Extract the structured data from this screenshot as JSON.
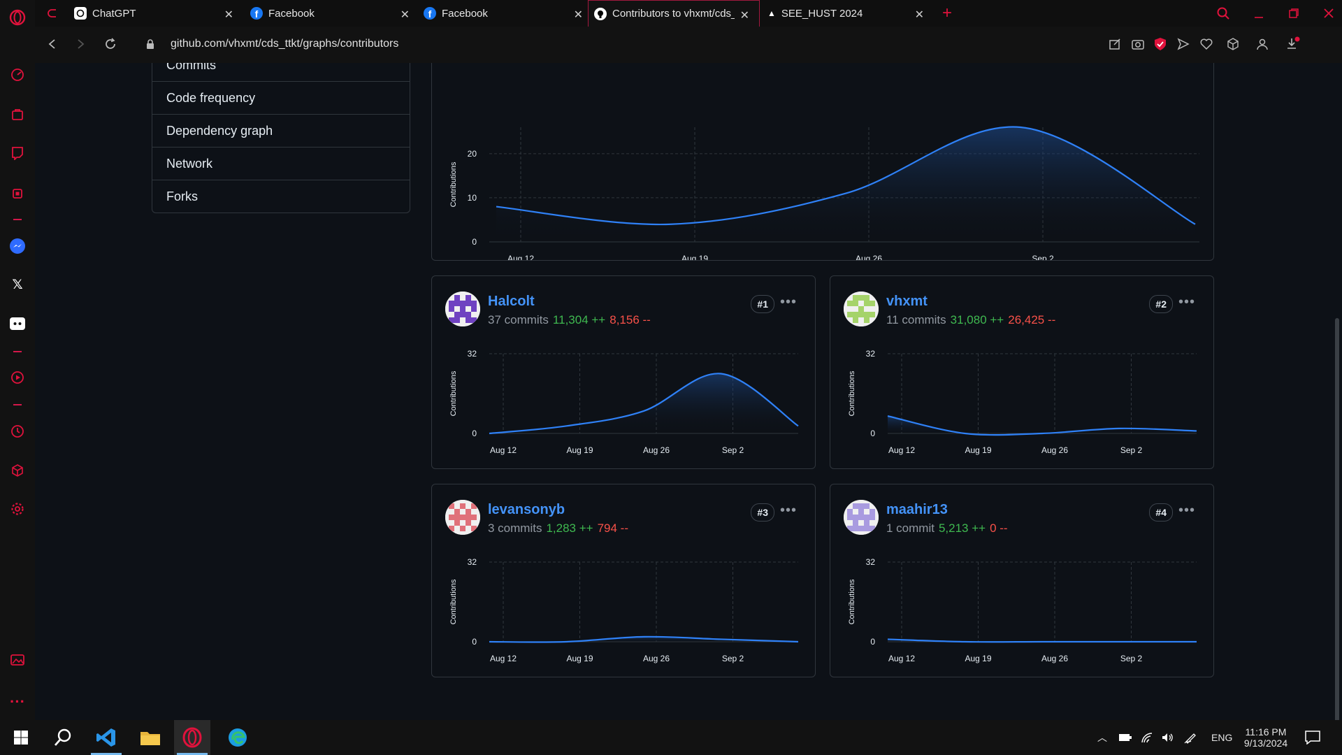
{
  "tabs": [
    {
      "title": "ChatGPT",
      "favicon": "chatgpt-icon"
    },
    {
      "title": "Facebook",
      "favicon": "facebook-icon"
    },
    {
      "title": "Facebook",
      "favicon": "facebook-icon"
    },
    {
      "title": "Contributors to vhxmt/cds_",
      "favicon": "github-icon",
      "active": true
    },
    {
      "title": "SEE_HUST 2024",
      "favicon": "triangle-icon"
    }
  ],
  "address": {
    "url": "github.com/vhxmt/cds_ttkt/graphs/contributors"
  },
  "graph_menu": {
    "items": [
      "Commits",
      "Code frequency",
      "Dependency graph",
      "Network",
      "Forks"
    ]
  },
  "colors": {
    "accent": "#2f81f7",
    "added": "#3fb950",
    "deleted": "#f85149",
    "opera": "#e0123c"
  },
  "chart_data": [
    {
      "type": "area",
      "title": "",
      "ylabel": "Contributions",
      "x_ticks": [
        "Aug 12",
        "Aug 19",
        "Aug 26",
        "Sep 2"
      ],
      "y_ticks": [
        0,
        10,
        20
      ],
      "ylim": [
        0,
        26
      ],
      "grid": true,
      "series": [
        {
          "x": [
            "Aug 11",
            "Aug 18",
            "Aug 25",
            "Sep 1",
            "Sep 8"
          ],
          "values": [
            8,
            4,
            11,
            26,
            4
          ]
        }
      ]
    },
    {
      "type": "area",
      "ylabel": "Contributions",
      "x_ticks": [
        "Aug 12",
        "Aug 19",
        "Aug 26",
        "Sep 2"
      ],
      "y_ticks": [
        0,
        32
      ],
      "ylim": [
        0,
        32
      ],
      "grid": true,
      "series": [
        {
          "values": [
            0,
            3,
            9,
            24,
            3
          ]
        }
      ]
    },
    {
      "type": "area",
      "ylabel": "Contributions",
      "x_ticks": [
        "Aug 12",
        "Aug 19",
        "Aug 26",
        "Sep 2"
      ],
      "y_ticks": [
        0,
        32
      ],
      "ylim": [
        0,
        32
      ],
      "grid": true,
      "series": [
        {
          "values": [
            7,
            0,
            0,
            2,
            1
          ]
        }
      ]
    },
    {
      "type": "area",
      "ylabel": "Contributions",
      "x_ticks": [
        "Aug 12",
        "Aug 19",
        "Aug 26",
        "Sep 2"
      ],
      "y_ticks": [
        0,
        32
      ],
      "ylim": [
        0,
        32
      ],
      "grid": true,
      "series": [
        {
          "values": [
            0,
            0,
            2,
            1,
            0
          ]
        }
      ]
    },
    {
      "type": "area",
      "ylabel": "Contributions",
      "x_ticks": [
        "Aug 12",
        "Aug 19",
        "Aug 26",
        "Sep 2"
      ],
      "y_ticks": [
        0,
        32
      ],
      "ylim": [
        0,
        32
      ],
      "grid": true,
      "series": [
        {
          "values": [
            1,
            0,
            0,
            0,
            0
          ]
        }
      ]
    }
  ],
  "contributors": [
    {
      "name": "Halcolt",
      "rank": "#1",
      "commits": "37 commits",
      "additions": "11,304 ++",
      "deletions": "8,156 --",
      "avatar_color": "#6f42c1"
    },
    {
      "name": "vhxmt",
      "rank": "#2",
      "commits": "11 commits",
      "additions": "31,080 ++",
      "deletions": "26,425 --",
      "avatar_color": "#a5d36a"
    },
    {
      "name": "levansonyb",
      "rank": "#3",
      "commits": "3 commits",
      "additions": "1,283 ++",
      "deletions": "794 --",
      "avatar_color": "#e0717a"
    },
    {
      "name": "maahir13",
      "rank": "#4",
      "commits": "1 commit",
      "additions": "5,213 ++",
      "deletions": "0 --",
      "avatar_color": "#a99be0"
    }
  ],
  "taskbar": {
    "language": "ENG",
    "time": "11:16 PM",
    "date": "9/13/2024"
  }
}
